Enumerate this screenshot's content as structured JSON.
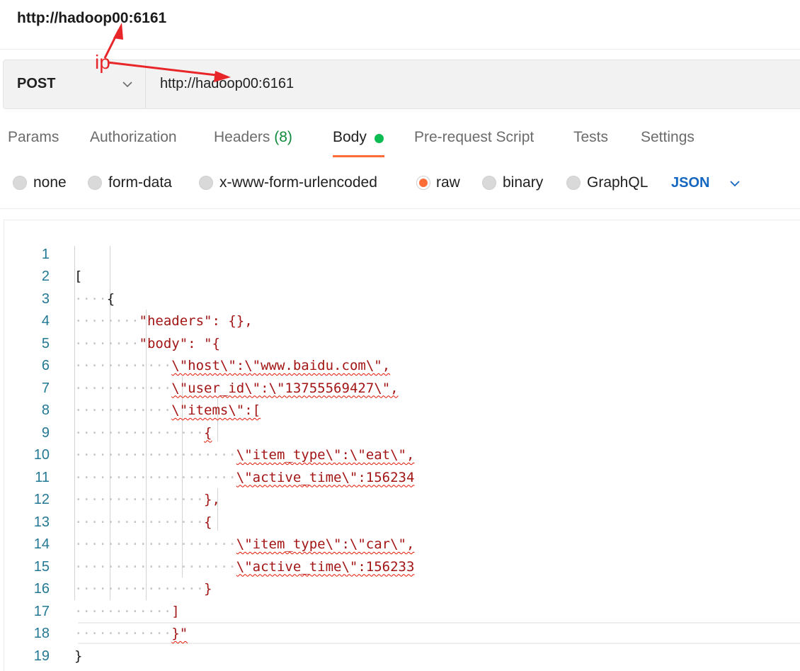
{
  "title": "http://hadoop00:6161",
  "request": {
    "method": "POST",
    "url": "http://hadoop00:6161"
  },
  "annotation": {
    "label": "ip",
    "color": "#e8262a"
  },
  "tabs": [
    {
      "label": "Params"
    },
    {
      "label": "Authorization"
    },
    {
      "label": "Headers",
      "count": "(8)"
    },
    {
      "label": "Body"
    },
    {
      "label": "Pre-request Script"
    },
    {
      "label": "Tests"
    },
    {
      "label": "Settings"
    }
  ],
  "active_tab": "Body",
  "body_types": [
    {
      "label": "none",
      "selected": false
    },
    {
      "label": "form-data",
      "selected": false
    },
    {
      "label": "x-www-form-urlencoded",
      "selected": false
    },
    {
      "label": "raw",
      "selected": true
    },
    {
      "label": "binary",
      "selected": false
    },
    {
      "label": "GraphQL",
      "selected": false
    }
  ],
  "format": "JSON",
  "colors": {
    "accent": "#ff6c37",
    "status_green": "#0cbb52",
    "json_blue": "#1566c0",
    "line_number": "#237893",
    "string": "#a31515"
  },
  "editor": {
    "lines": [
      {
        "n": "1",
        "text": "["
      },
      {
        "n": "2",
        "text": "{"
      },
      {
        "n": "3",
        "text": "\"headers\": {},"
      },
      {
        "n": "4",
        "text": "\"body\": \"{"
      },
      {
        "n": "5",
        "text": "\\\"host\\\":\\\"www.baidu.com\\\","
      },
      {
        "n": "6",
        "text": "\\\"user_id\\\":\\\"13755569427\\\","
      },
      {
        "n": "7",
        "text": "\\\"items\\\":["
      },
      {
        "n": "8",
        "text": "{"
      },
      {
        "n": "9",
        "text": "\\\"item_type\\\":\\\"eat\\\","
      },
      {
        "n": "10",
        "text": "\\\"active_time\\\":156234"
      },
      {
        "n": "11",
        "text": "},"
      },
      {
        "n": "12",
        "text": "{"
      },
      {
        "n": "13",
        "text": "\\\"item_type\\\":\\\"car\\\","
      },
      {
        "n": "14",
        "text": "\\\"active_time\\\":156233"
      },
      {
        "n": "15",
        "text": "}"
      },
      {
        "n": "16",
        "text": "]"
      },
      {
        "n": "17",
        "text": "}\""
      },
      {
        "n": "18",
        "text": "}"
      },
      {
        "n": "19",
        "text": "]"
      }
    ]
  }
}
